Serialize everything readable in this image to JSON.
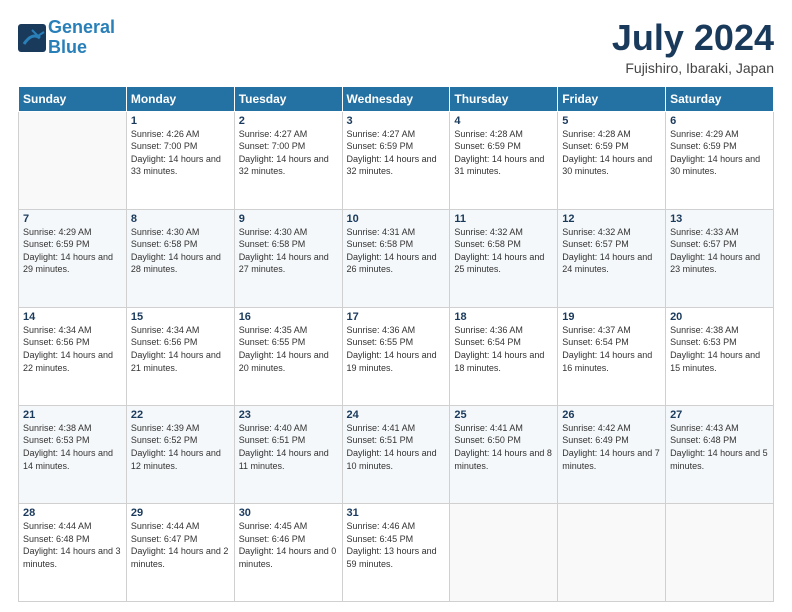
{
  "header": {
    "logo_line1": "General",
    "logo_line2": "Blue",
    "month": "July 2024",
    "location": "Fujishiro, Ibaraki, Japan"
  },
  "days_of_week": [
    "Sunday",
    "Monday",
    "Tuesday",
    "Wednesday",
    "Thursday",
    "Friday",
    "Saturday"
  ],
  "weeks": [
    [
      {
        "day": "",
        "sunrise": "",
        "sunset": "",
        "daylight": ""
      },
      {
        "day": "1",
        "sunrise": "4:26 AM",
        "sunset": "7:00 PM",
        "daylight": "14 hours and 33 minutes."
      },
      {
        "day": "2",
        "sunrise": "4:27 AM",
        "sunset": "7:00 PM",
        "daylight": "14 hours and 32 minutes."
      },
      {
        "day": "3",
        "sunrise": "4:27 AM",
        "sunset": "6:59 PM",
        "daylight": "14 hours and 32 minutes."
      },
      {
        "day": "4",
        "sunrise": "4:28 AM",
        "sunset": "6:59 PM",
        "daylight": "14 hours and 31 minutes."
      },
      {
        "day": "5",
        "sunrise": "4:28 AM",
        "sunset": "6:59 PM",
        "daylight": "14 hours and 30 minutes."
      },
      {
        "day": "6",
        "sunrise": "4:29 AM",
        "sunset": "6:59 PM",
        "daylight": "14 hours and 30 minutes."
      }
    ],
    [
      {
        "day": "7",
        "sunrise": "4:29 AM",
        "sunset": "6:59 PM",
        "daylight": "14 hours and 29 minutes."
      },
      {
        "day": "8",
        "sunrise": "4:30 AM",
        "sunset": "6:58 PM",
        "daylight": "14 hours and 28 minutes."
      },
      {
        "day": "9",
        "sunrise": "4:30 AM",
        "sunset": "6:58 PM",
        "daylight": "14 hours and 27 minutes."
      },
      {
        "day": "10",
        "sunrise": "4:31 AM",
        "sunset": "6:58 PM",
        "daylight": "14 hours and 26 minutes."
      },
      {
        "day": "11",
        "sunrise": "4:32 AM",
        "sunset": "6:58 PM",
        "daylight": "14 hours and 25 minutes."
      },
      {
        "day": "12",
        "sunrise": "4:32 AM",
        "sunset": "6:57 PM",
        "daylight": "14 hours and 24 minutes."
      },
      {
        "day": "13",
        "sunrise": "4:33 AM",
        "sunset": "6:57 PM",
        "daylight": "14 hours and 23 minutes."
      }
    ],
    [
      {
        "day": "14",
        "sunrise": "4:34 AM",
        "sunset": "6:56 PM",
        "daylight": "14 hours and 22 minutes."
      },
      {
        "day": "15",
        "sunrise": "4:34 AM",
        "sunset": "6:56 PM",
        "daylight": "14 hours and 21 minutes."
      },
      {
        "day": "16",
        "sunrise": "4:35 AM",
        "sunset": "6:55 PM",
        "daylight": "14 hours and 20 minutes."
      },
      {
        "day": "17",
        "sunrise": "4:36 AM",
        "sunset": "6:55 PM",
        "daylight": "14 hours and 19 minutes."
      },
      {
        "day": "18",
        "sunrise": "4:36 AM",
        "sunset": "6:54 PM",
        "daylight": "14 hours and 18 minutes."
      },
      {
        "day": "19",
        "sunrise": "4:37 AM",
        "sunset": "6:54 PM",
        "daylight": "14 hours and 16 minutes."
      },
      {
        "day": "20",
        "sunrise": "4:38 AM",
        "sunset": "6:53 PM",
        "daylight": "14 hours and 15 minutes."
      }
    ],
    [
      {
        "day": "21",
        "sunrise": "4:38 AM",
        "sunset": "6:53 PM",
        "daylight": "14 hours and 14 minutes."
      },
      {
        "day": "22",
        "sunrise": "4:39 AM",
        "sunset": "6:52 PM",
        "daylight": "14 hours and 12 minutes."
      },
      {
        "day": "23",
        "sunrise": "4:40 AM",
        "sunset": "6:51 PM",
        "daylight": "14 hours and 11 minutes."
      },
      {
        "day": "24",
        "sunrise": "4:41 AM",
        "sunset": "6:51 PM",
        "daylight": "14 hours and 10 minutes."
      },
      {
        "day": "25",
        "sunrise": "4:41 AM",
        "sunset": "6:50 PM",
        "daylight": "14 hours and 8 minutes."
      },
      {
        "day": "26",
        "sunrise": "4:42 AM",
        "sunset": "6:49 PM",
        "daylight": "14 hours and 7 minutes."
      },
      {
        "day": "27",
        "sunrise": "4:43 AM",
        "sunset": "6:48 PM",
        "daylight": "14 hours and 5 minutes."
      }
    ],
    [
      {
        "day": "28",
        "sunrise": "4:44 AM",
        "sunset": "6:48 PM",
        "daylight": "14 hours and 3 minutes."
      },
      {
        "day": "29",
        "sunrise": "4:44 AM",
        "sunset": "6:47 PM",
        "daylight": "14 hours and 2 minutes."
      },
      {
        "day": "30",
        "sunrise": "4:45 AM",
        "sunset": "6:46 PM",
        "daylight": "14 hours and 0 minutes."
      },
      {
        "day": "31",
        "sunrise": "4:46 AM",
        "sunset": "6:45 PM",
        "daylight": "13 hours and 59 minutes."
      },
      {
        "day": "",
        "sunrise": "",
        "sunset": "",
        "daylight": ""
      },
      {
        "day": "",
        "sunrise": "",
        "sunset": "",
        "daylight": ""
      },
      {
        "day": "",
        "sunrise": "",
        "sunset": "",
        "daylight": ""
      }
    ]
  ]
}
